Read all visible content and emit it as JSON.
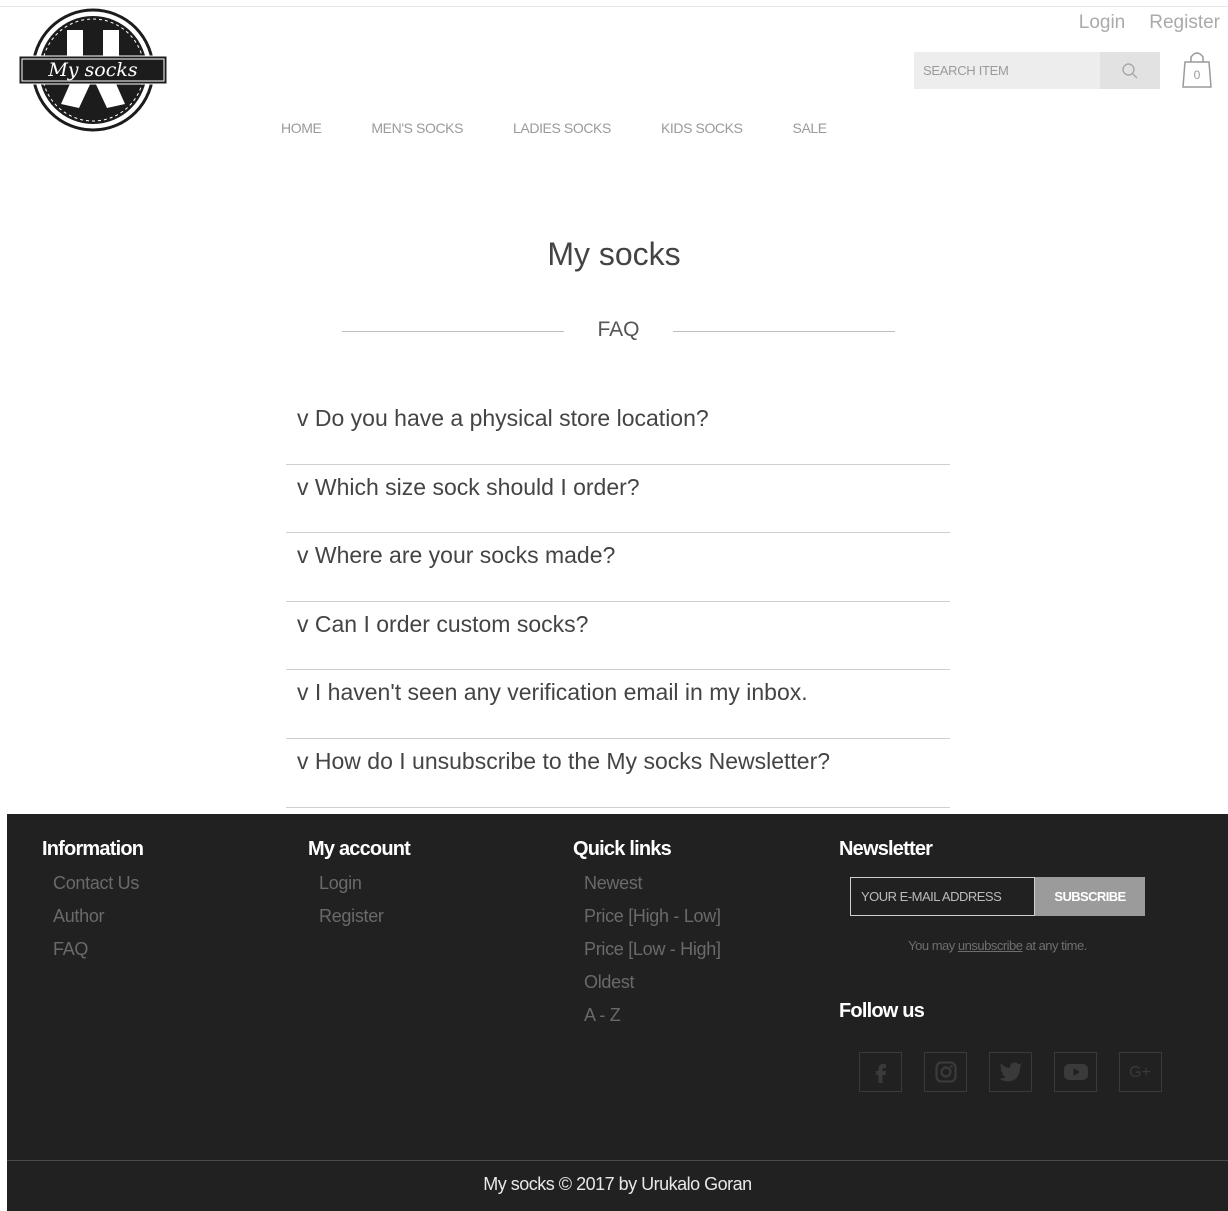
{
  "header": {
    "logo_text": "My socks",
    "auth": {
      "login": "Login",
      "register": "Register"
    },
    "search": {
      "placeholder": "SEARCH ITEM"
    },
    "cart_count": "0",
    "nav": [
      "HOME",
      "MEN'S SOCKS",
      "LADIES SOCKS",
      "KIDS SOCKS",
      "SALE"
    ]
  },
  "main": {
    "title": "My socks",
    "section": "FAQ",
    "questions": [
      "v Do you have a physical store location?",
      "v Which size sock should I order?",
      "v Where are your socks made?",
      "v Can I order custom socks?",
      "v I haven't seen any verification email in my inbox.",
      "v How do I unsubscribe to the My socks Newsletter?"
    ]
  },
  "footer": {
    "information": {
      "title": "Information",
      "items": [
        "Contact Us",
        "Author",
        "FAQ"
      ]
    },
    "account": {
      "title": "My account",
      "items": [
        "Login",
        "Register"
      ]
    },
    "quicklinks": {
      "title": "Quick links",
      "items": [
        "Newest",
        "Price [High - Low]",
        "Price [Low - High]",
        "Oldest",
        "A - Z"
      ]
    },
    "newsletter": {
      "title": "Newsletter",
      "placeholder": "YOUR E-MAIL ADDRESS",
      "button": "SUBSCRIBE",
      "note_before": "You may ",
      "note_link": "unsubscribe",
      "note_after": " at any time."
    },
    "follow_title": "Follow us",
    "socials": [
      "facebook-icon",
      "instagram-icon",
      "twitter-icon",
      "youtube-icon",
      "google-plus-icon"
    ],
    "copyright": "My socks © 2017 by Urukalo Goran"
  }
}
